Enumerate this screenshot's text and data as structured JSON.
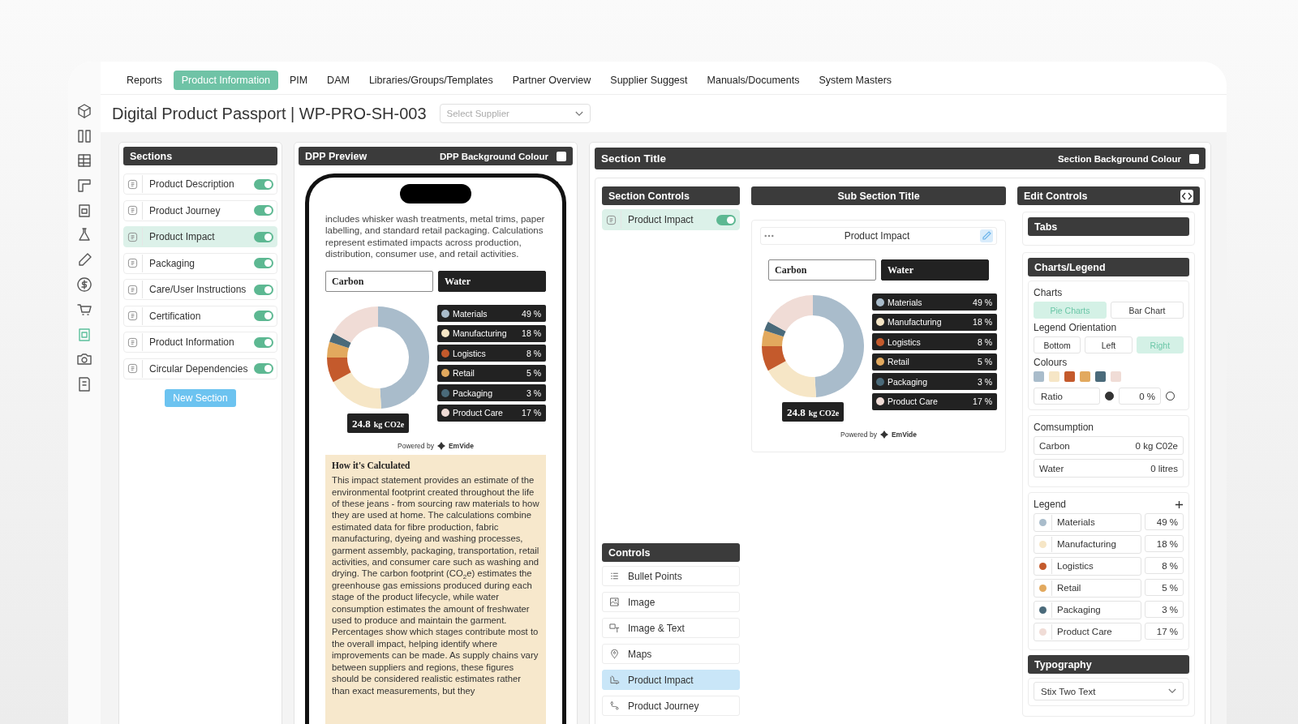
{
  "nav": {
    "tabs": [
      {
        "label": "Reports",
        "selected": false
      },
      {
        "label": "Product Information",
        "selected": true
      },
      {
        "label": "PIM",
        "selected": false
      },
      {
        "label": "DAM",
        "selected": false
      },
      {
        "label": "Libraries/Groups/Templates",
        "selected": false
      },
      {
        "label": "Partner Overview",
        "selected": false
      },
      {
        "label": "Supplier Suggest",
        "selected": false
      },
      {
        "label": "Manuals/Documents",
        "selected": false
      },
      {
        "label": "System Masters",
        "selected": false
      }
    ]
  },
  "header": {
    "title": "Digital Product Passport | WP-PRO-SH-003",
    "supplier_select": {
      "placeholder": "Select Supplier"
    }
  },
  "rail": [
    {
      "selected": false
    },
    {
      "selected": false
    },
    {
      "selected": false
    },
    {
      "selected": false
    },
    {
      "selected": false
    },
    {
      "selected": false
    },
    {
      "selected": false
    },
    {
      "selected": false
    },
    {
      "selected": false
    },
    {
      "selected": true
    },
    {
      "selected": false
    },
    {
      "selected": false
    }
  ],
  "sections_panel": {
    "title": "Sections",
    "items": [
      {
        "label": "Product Description",
        "on": true,
        "selected": false
      },
      {
        "label": "Product Journey",
        "on": true,
        "selected": false
      },
      {
        "label": "Product Impact",
        "on": true,
        "selected": true
      },
      {
        "label": "Packaging",
        "on": true,
        "selected": false
      },
      {
        "label": "Care/User Instructions",
        "on": true,
        "selected": false
      },
      {
        "label": "Certification",
        "on": true,
        "selected": false
      },
      {
        "label": "Product Information",
        "on": true,
        "selected": false
      },
      {
        "label": "Circular Dependencies",
        "on": true,
        "selected": false
      }
    ],
    "new_button": "New Section"
  },
  "preview": {
    "title": "DPP Preview",
    "background_label": "DPP Background Colour",
    "intro": "includes whisker wash treatments, metal trims, paper labelling, and standard retail packaging. Calculations represent estimated impacts across production, distribution, consumer use, and retail activities.",
    "tabs": [
      {
        "label": "Carbon",
        "selected": true
      },
      {
        "label": "Water",
        "selected": false
      }
    ],
    "legend": [
      {
        "value": "49 %",
        "color": "#a9bccb"
      },
      {
        "value": "18 %",
        "color": "#f6e6c6"
      },
      {
        "value": "8 %",
        "color": "#c45a2c"
      },
      {
        "value": "5 %",
        "color": "#e2a95e"
      },
      {
        "value": "3 %",
        "color": "#4a6a7a"
      },
      {
        "value": "17 %",
        "color": "#f0dcd6"
      }
    ],
    "chart_data": {
      "type": "donut",
      "categories": [
        "Materials",
        "Manufacturing",
        "Logistics",
        "Retail",
        "Packaging",
        "Product Care"
      ],
      "values": [
        49,
        18,
        8,
        5,
        3,
        17
      ]
    },
    "total": {
      "value": "24.8",
      "unit": "kg CO2e"
    },
    "powered_by": "Powered by",
    "brand": "EmVide",
    "calc": {
      "title": "How it's Calculated",
      "text": "This impact statement provides an estimate of the environmental footprint created throughout the life of these jeans - from sourcing raw materials to how they are used at home. The calculations combine estimated data for fibre production, fabric manufacturing, dyeing and washing processes, garment assembly, packaging, transportation, retail activities, and consumer care such as washing and drying. The carbon footprint (CO$_{2}$e) estimates the greenhouse gas emissions produced during each stage of the product lifecycle, while water consumption estimates the amount of freshwater used to produce and maintain the garment. Percentages show which stages contribute most to the overall impact, helping identify where improvements can be made. As supply chains vary between suppliers and regions, these figures should be considered realistic estimates rather than exact measurements, but they"
    }
  },
  "section": {
    "title": "Section Title",
    "background_label": "Section Background Colour",
    "controls_title": "Section Controls",
    "controls_items": [
      {
        "label": "Product Impact",
        "on": true,
        "selected": true
      }
    ],
    "sub_title": "Sub Section Title",
    "sub": {
      "name": "Product Impact",
      "tabs": [
        {
          "label": "Carbon",
          "selected": true
        },
        {
          "label": "Water",
          "selected": false
        }
      ],
      "legend": [
        {
          "value": "49 %",
          "color": "#a9bccb"
        },
        {
          "value": "18 %",
          "color": "#f6e6c6"
        },
        {
          "value": "8 %",
          "color": "#c45a2c"
        },
        {
          "value": "5 %",
          "color": "#e2a95e"
        },
        {
          "value": "3 %",
          "color": "#4a6a7a"
        },
        {
          "value": "17 %",
          "color": "#f0dcd6"
        }
      ],
      "chart_data": {
        "type": "donut",
        "categories": [
          "Materials",
          "Manufacturing",
          "Logistics",
          "Retail",
          "Packaging",
          "Product Care"
        ],
        "values": [
          49,
          18,
          8,
          5,
          3,
          17
        ]
      },
      "total": {
        "value": "24.8",
        "unit": "kg CO2e"
      },
      "powered_by": "Powered by",
      "brand": "EmVide"
    },
    "palette_title": "Controls",
    "palette": [
      {
        "label": "Bullet Points",
        "selected": false
      },
      {
        "label": "Image",
        "selected": false
      },
      {
        "label": "Image & Text",
        "selected": false
      },
      {
        "label": "Maps",
        "selected": false
      },
      {
        "label": "Product Impact",
        "selected": true
      },
      {
        "label": "Product Journey",
        "selected": false
      }
    ],
    "edit": {
      "title": "Edit Controls",
      "tabs_title": "Tabs",
      "charts_legend_title": "Charts/Legend",
      "charts_label": "Charts",
      "chart_types": [
        {
          "label": "Pie Charts",
          "selected": true
        },
        {
          "label": "Bar Chart",
          "selected": false
        }
      ],
      "orientation_label": "Legend Orientation",
      "orientations": [
        {
          "label": "Bottom",
          "selected": false
        },
        {
          "label": "Left",
          "selected": false
        },
        {
          "label": "Right",
          "selected": true
        }
      ],
      "colours_label": "Colours",
      "colours": [
        {
          "color": "#a9bccb"
        },
        {
          "color": "#f6e6c6"
        },
        {
          "color": "#c45a2c"
        },
        {
          "color": "#e2a95e"
        },
        {
          "color": "#4a6a7a"
        },
        {
          "color": "#f0dcd6"
        }
      ],
      "ratio": {
        "label": "Ratio",
        "value": "0 %"
      },
      "consumption_label": "Comsumption",
      "consumption": [
        {
          "label": "Carbon",
          "value": "0 kg C02e"
        },
        {
          "label": "Water",
          "value": "0 litres"
        }
      ],
      "legend_label": "Legend",
      "legend": [
        {
          "label": "Materials",
          "value": "49 %",
          "color": "#a9bccb"
        },
        {
          "label": "Manufacturing",
          "value": "18 %",
          "color": "#f6e6c6"
        },
        {
          "label": "Logistics",
          "value": "8 %",
          "color": "#c45a2c"
        },
        {
          "label": "Retail",
          "value": "5 %",
          "color": "#e2a95e"
        },
        {
          "label": "Packaging",
          "value": "3 %",
          "color": "#4a6a7a"
        },
        {
          "label": "Product Care",
          "value": "17 %",
          "color": "#f0dcd6"
        }
      ],
      "typography_title": "Typography",
      "font": "Stix Two Text"
    }
  }
}
